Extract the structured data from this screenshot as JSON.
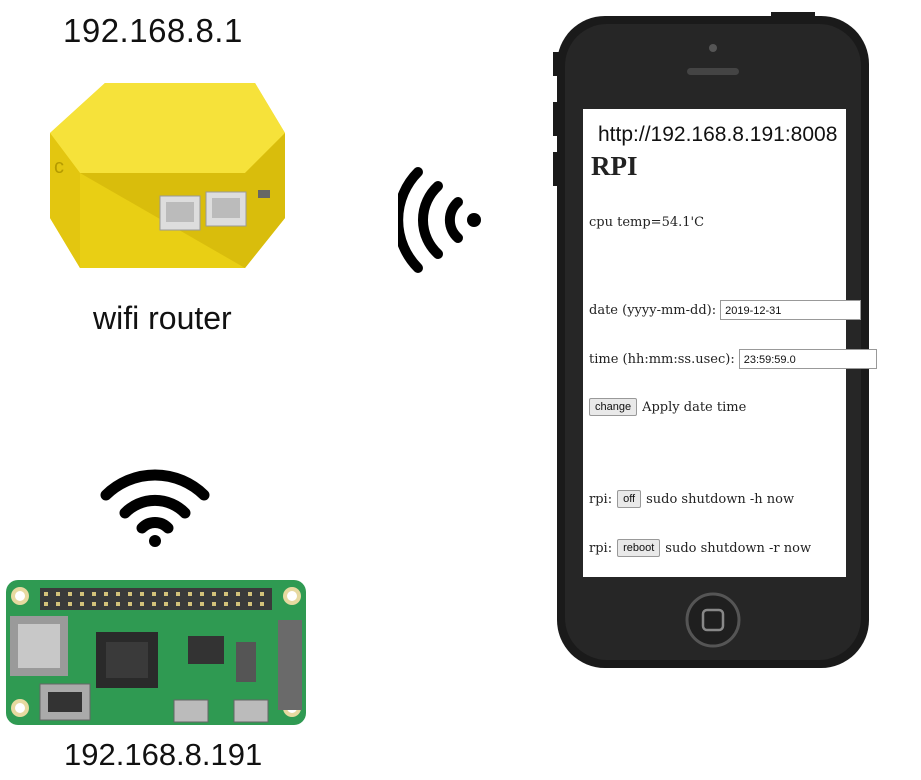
{
  "router": {
    "ip": "192.168.8.1",
    "caption": "wifi router"
  },
  "pi": {
    "ip": "192.168.8.191"
  },
  "phone": {
    "url": "http://192.168.8.191:8008",
    "page_title": "RPI",
    "cpu_temp": "cpu temp=54.1'C",
    "date_label": "date (yyyy-mm-dd):",
    "date_value": "2019-12-31",
    "time_label": "time (hh:mm:ss.usec):",
    "time_value": "23:59:59.0",
    "change_button": "change",
    "change_text": "Apply date time",
    "rpi_label": "rpi:",
    "off_button": "off",
    "off_text": "sudo shutdown -h now",
    "reboot_button": "reboot",
    "reboot_text": "sudo shutdown -r now"
  },
  "colors": {
    "router_yellow": "#f2dc2a",
    "pcb_green": "#2f9a52",
    "phone_body": "#1a1a1a"
  },
  "icons": [
    "wireless-signal-icon",
    "wifi-icon"
  ]
}
